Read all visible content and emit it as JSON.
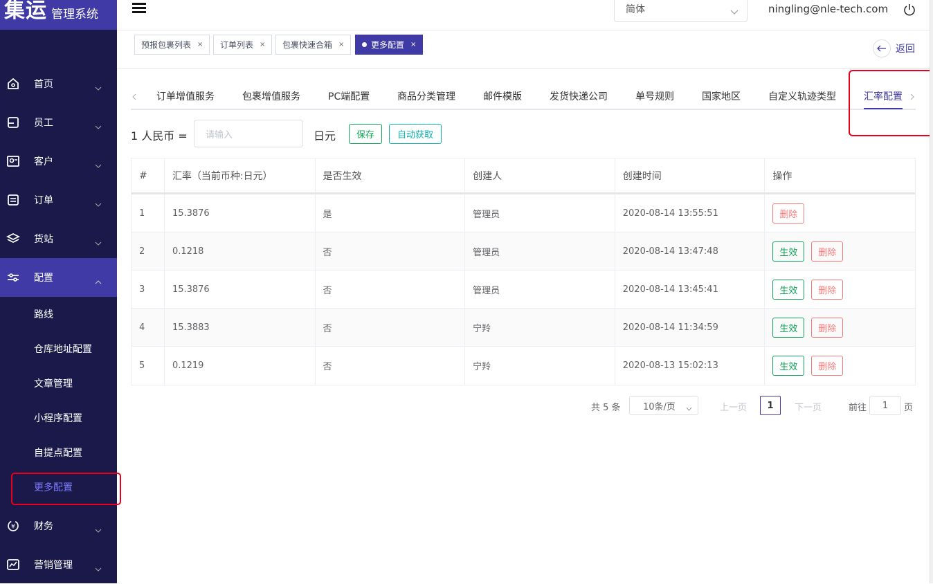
{
  "brand": {
    "big": "集运",
    "small": "管理系统"
  },
  "sidebar": {
    "items": [
      {
        "label": "首页",
        "icon": "home-icon"
      },
      {
        "label": "员工",
        "icon": "employee-icon"
      },
      {
        "label": "客户",
        "icon": "customer-icon"
      },
      {
        "label": "订单",
        "icon": "order-icon"
      },
      {
        "label": "货站",
        "icon": "station-icon"
      },
      {
        "label": "配置",
        "icon": "settings-sliders-icon"
      },
      {
        "label": "财务",
        "icon": "finance-icon"
      },
      {
        "label": "营销管理",
        "icon": "marketing-chart-icon"
      }
    ],
    "subitems": [
      "路线",
      "仓库地址配置",
      "文章管理",
      "小程序配置",
      "自提点配置",
      "更多配置"
    ]
  },
  "header": {
    "language": "简体",
    "email": "ningling@nle-tech.com"
  },
  "tags": [
    "预报包裹列表",
    "订单列表",
    "包裹快速合箱",
    "更多配置"
  ],
  "back_label": "返回",
  "inner_tabs": [
    "订单增值服务",
    "包裹增值服务",
    "PC端配置",
    "商品分类管理",
    "邮件模版",
    "发货快递公司",
    "单号规则",
    "国家地区",
    "自定义轨迹类型",
    "汇率配置"
  ],
  "form": {
    "rate_label": "1 人民币 =",
    "placeholder": "请输入",
    "unit": "日元",
    "save": "保存",
    "auto": "自动获取"
  },
  "table": {
    "headers": [
      "#",
      "汇率（当前币种:日元）",
      "是否生效",
      "创建人",
      "创建时间",
      "操作"
    ],
    "rows": [
      {
        "n": "1",
        "rate": "15.3876",
        "effective": "是",
        "creator": "管理员",
        "time": "2020-08-14 13:55:51"
      },
      {
        "n": "2",
        "rate": "0.1218",
        "effective": "否",
        "creator": "管理员",
        "time": "2020-08-14 13:47:48"
      },
      {
        "n": "3",
        "rate": "15.3876",
        "effective": "否",
        "creator": "管理员",
        "time": "2020-08-14 13:45:41"
      },
      {
        "n": "4",
        "rate": "15.3883",
        "effective": "否",
        "creator": "宁羚",
        "time": "2020-08-14 11:34:59"
      },
      {
        "n": "5",
        "rate": "0.1219",
        "effective": "否",
        "creator": "宁羚",
        "time": "2020-08-13 15:02:13"
      }
    ],
    "btn_effective": "生效",
    "btn_delete": "删除"
  },
  "pagination": {
    "total": "共 5 条",
    "size": "10条/页",
    "prev": "上一页",
    "page": "1",
    "next": "下一页",
    "goto": "前往",
    "goto_value": "1",
    "page_unit": "页"
  }
}
